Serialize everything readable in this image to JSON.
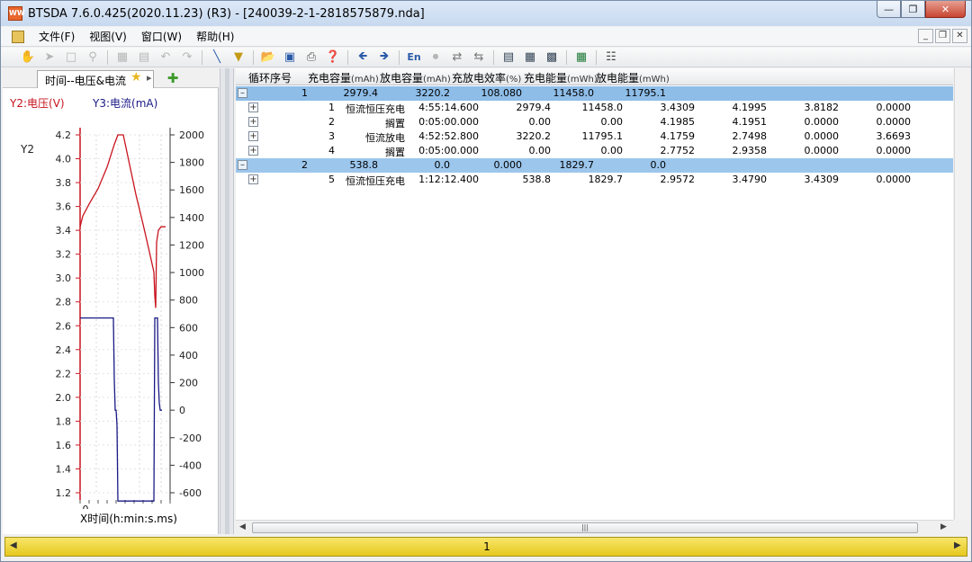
{
  "window": {
    "title": "BTSDA 7.6.0.425(2020.11.23) (R3) - [240039-2-1-2818575879.nda]",
    "icon": "app-icon"
  },
  "menu": [
    "文件(F)",
    "视图(V)",
    "窗口(W)",
    "帮助(H)"
  ],
  "chart_panel": {
    "tab_label": "时间--电压&电流",
    "y2_legend": "Y2:电压(V)",
    "y3_legend": "Y3:电流(mA)",
    "y2_axis_title": "Y2",
    "x_tick": "0",
    "x_axis_label": "X时间(h:min:s.ms)"
  },
  "chart_data": {
    "type": "line",
    "title": "",
    "xlabel": "X时间(h:min:s.ms)",
    "y2": {
      "label": "Y2:电压(V)",
      "ticks": [
        4.2,
        4.0,
        3.8,
        3.6,
        3.4,
        3.2,
        3.0,
        2.8,
        2.6,
        2.4,
        2.2,
        2.0,
        1.8,
        1.6,
        1.4,
        1.2
      ],
      "ylim": [
        1.2,
        4.2
      ],
      "color": "#c8141e"
    },
    "y3": {
      "label": "Y3:电流(mA)",
      "ticks": [
        2000,
        1800,
        1600,
        1400,
        1200,
        1000,
        800,
        600,
        400,
        200,
        0,
        -200,
        -400,
        -600
      ],
      "ylim": [
        -600,
        2000
      ],
      "color": "#1a1a86"
    },
    "xlim": [
      0,
      100
    ],
    "series": [
      {
        "axis": "y2",
        "x": [
          0,
          3,
          10,
          20,
          30,
          38,
          42,
          48,
          55,
          62,
          70,
          77,
          82,
          83,
          84,
          85,
          87,
          90,
          95
        ],
        "values": [
          3.43,
          3.52,
          3.62,
          3.75,
          3.93,
          4.12,
          4.2,
          4.2,
          3.95,
          3.7,
          3.45,
          3.22,
          3.05,
          2.85,
          2.75,
          3.3,
          3.4,
          3.43,
          3.43
        ]
      },
      {
        "axis": "y3",
        "x": [
          0,
          37,
          38,
          39,
          40,
          41,
          42,
          44,
          82,
          83,
          86,
          87,
          88,
          89,
          90,
          91
        ],
        "values": [
          670,
          670,
          220,
          0,
          0,
          -110,
          -660,
          -660,
          -660,
          670,
          670,
          200,
          50,
          0,
          0,
          0
        ]
      }
    ]
  },
  "grid": {
    "headers": [
      {
        "main": "循环序号",
        "unit": ""
      },
      {
        "main": "充电容量",
        "unit": "(mAh)"
      },
      {
        "main": "放电容量",
        "unit": "(mAh)"
      },
      {
        "main": "充放电效率",
        "unit": "(%)"
      },
      {
        "main": "充电能量",
        "unit": "(mWh)"
      },
      {
        "main": "放电能量",
        "unit": "(mWh)"
      }
    ],
    "cycles": [
      {
        "num": "1",
        "charge_cap": "2979.4",
        "discharge_cap": "3220.2",
        "efficiency": "108.080",
        "charge_energy": "11458.0",
        "discharge_energy": "11795.1",
        "steps": [
          {
            "num": "1",
            "name": "恒流恒压充电",
            "time": "4:55:14.600",
            "c1": "2979.4",
            "c2": "11458.0",
            "c3": "3.4309",
            "c4": "4.1995",
            "c5": "3.8182",
            "c6": "0.0000"
          },
          {
            "num": "2",
            "name": "搁置",
            "time": "0:05:00.000",
            "c1": "0.00",
            "c2": "0.00",
            "c3": "4.1985",
            "c4": "4.1951",
            "c5": "0.0000",
            "c6": "0.0000"
          },
          {
            "num": "3",
            "name": "恒流放电",
            "time": "4:52:52.800",
            "c1": "3220.2",
            "c2": "11795.1",
            "c3": "4.1759",
            "c4": "2.7498",
            "c5": "0.0000",
            "c6": "3.6693"
          },
          {
            "num": "4",
            "name": "搁置",
            "time": "0:05:00.000",
            "c1": "0.00",
            "c2": "0.00",
            "c3": "2.7752",
            "c4": "2.9358",
            "c5": "0.0000",
            "c6": "0.0000"
          }
        ]
      },
      {
        "num": "2",
        "charge_cap": "538.8",
        "discharge_cap": "0.0",
        "efficiency": "0.000",
        "charge_energy": "1829.7",
        "discharge_energy": "0.0",
        "steps": [
          {
            "num": "5",
            "name": "恒流恒压充电",
            "time": "1:12:12.400",
            "c1": "538.8",
            "c2": "1829.7",
            "c3": "2.9572",
            "c4": "3.4790",
            "c5": "3.4309",
            "c6": "0.0000"
          }
        ]
      }
    ]
  },
  "statusbar": {
    "page": "1"
  }
}
